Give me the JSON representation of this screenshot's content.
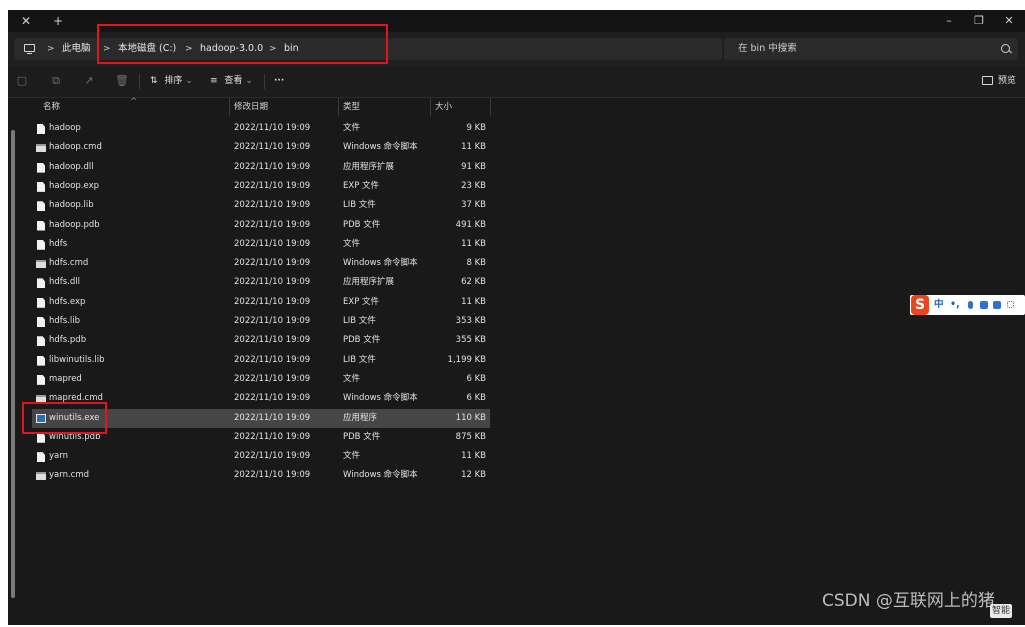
{
  "titlebar": {
    "close_tab_label": "✕",
    "new_tab_label": "+",
    "minimize_label": "–",
    "restore_label": "❐",
    "close_window_label": "✕"
  },
  "address": {
    "root_icon": "computer-icon",
    "separator": ">",
    "crumbs": [
      "此电脑",
      "本地磁盘 (C:)",
      "hadoop-3.0.0",
      "bin"
    ]
  },
  "search": {
    "placeholder": "在 bin 中搜索",
    "icon": "search-icon"
  },
  "toolbar": {
    "sort_label": "排序",
    "view_label": "查看",
    "more_label": "···",
    "preview_label": "预览",
    "chevron": "⌄",
    "sort_icon": "⇅",
    "view_icon": "≡"
  },
  "columns": {
    "name": "名称",
    "modified": "修改日期",
    "type": "类型",
    "size": "大小"
  },
  "files": [
    {
      "name": "hadoop",
      "modified": "2022/11/10 19:09",
      "type": "文件",
      "size": "9 KB",
      "icon": "file"
    },
    {
      "name": "hadoop.cmd",
      "modified": "2022/11/10 19:09",
      "type": "Windows 命令脚本",
      "size": "11 KB",
      "icon": "cmd"
    },
    {
      "name": "hadoop.dll",
      "modified": "2022/11/10 19:09",
      "type": "应用程序扩展",
      "size": "91 KB",
      "icon": "file"
    },
    {
      "name": "hadoop.exp",
      "modified": "2022/11/10 19:09",
      "type": "EXP 文件",
      "size": "23 KB",
      "icon": "file"
    },
    {
      "name": "hadoop.lib",
      "modified": "2022/11/10 19:09",
      "type": "LIB 文件",
      "size": "37 KB",
      "icon": "file"
    },
    {
      "name": "hadoop.pdb",
      "modified": "2022/11/10 19:09",
      "type": "PDB 文件",
      "size": "491 KB",
      "icon": "file"
    },
    {
      "name": "hdfs",
      "modified": "2022/11/10 19:09",
      "type": "文件",
      "size": "11 KB",
      "icon": "file"
    },
    {
      "name": "hdfs.cmd",
      "modified": "2022/11/10 19:09",
      "type": "Windows 命令脚本",
      "size": "8 KB",
      "icon": "cmd"
    },
    {
      "name": "hdfs.dll",
      "modified": "2022/11/10 19:09",
      "type": "应用程序扩展",
      "size": "62 KB",
      "icon": "file"
    },
    {
      "name": "hdfs.exp",
      "modified": "2022/11/10 19:09",
      "type": "EXP 文件",
      "size": "11 KB",
      "icon": "file"
    },
    {
      "name": "hdfs.lib",
      "modified": "2022/11/10 19:09",
      "type": "LIB 文件",
      "size": "353 KB",
      "icon": "file"
    },
    {
      "name": "hdfs.pdb",
      "modified": "2022/11/10 19:09",
      "type": "PDB 文件",
      "size": "355 KB",
      "icon": "file"
    },
    {
      "name": "libwinutils.lib",
      "modified": "2022/11/10 19:09",
      "type": "LIB 文件",
      "size": "1,199 KB",
      "icon": "file"
    },
    {
      "name": "mapred",
      "modified": "2022/11/10 19:09",
      "type": "文件",
      "size": "6 KB",
      "icon": "file"
    },
    {
      "name": "mapred.cmd",
      "modified": "2022/11/10 19:09",
      "type": "Windows 命令脚本",
      "size": "6 KB",
      "icon": "cmd"
    },
    {
      "name": "winutils.exe",
      "modified": "2022/11/10 19:09",
      "type": "应用程序",
      "size": "110 KB",
      "icon": "exe",
      "selected": true
    },
    {
      "name": "winutils.pdb",
      "modified": "2022/11/10 19:09",
      "type": "PDB 文件",
      "size": "875 KB",
      "icon": "file"
    },
    {
      "name": "yarn",
      "modified": "2022/11/10 19:09",
      "type": "文件",
      "size": "11 KB",
      "icon": "file"
    },
    {
      "name": "yarn.cmd",
      "modified": "2022/11/10 19:09",
      "type": "Windows 命令脚本",
      "size": "12 KB",
      "icon": "cmd"
    }
  ],
  "ime": {
    "logo": "S",
    "mode": "中",
    "punct": "•,"
  },
  "watermark": {
    "text": "CSDN @互联网上的猪",
    "tail": "智能"
  },
  "colors": {
    "window_bg": "#191919",
    "selected_row": "#464646",
    "highlight_red": "#e0151d",
    "ime_brand": "#e8471d"
  }
}
